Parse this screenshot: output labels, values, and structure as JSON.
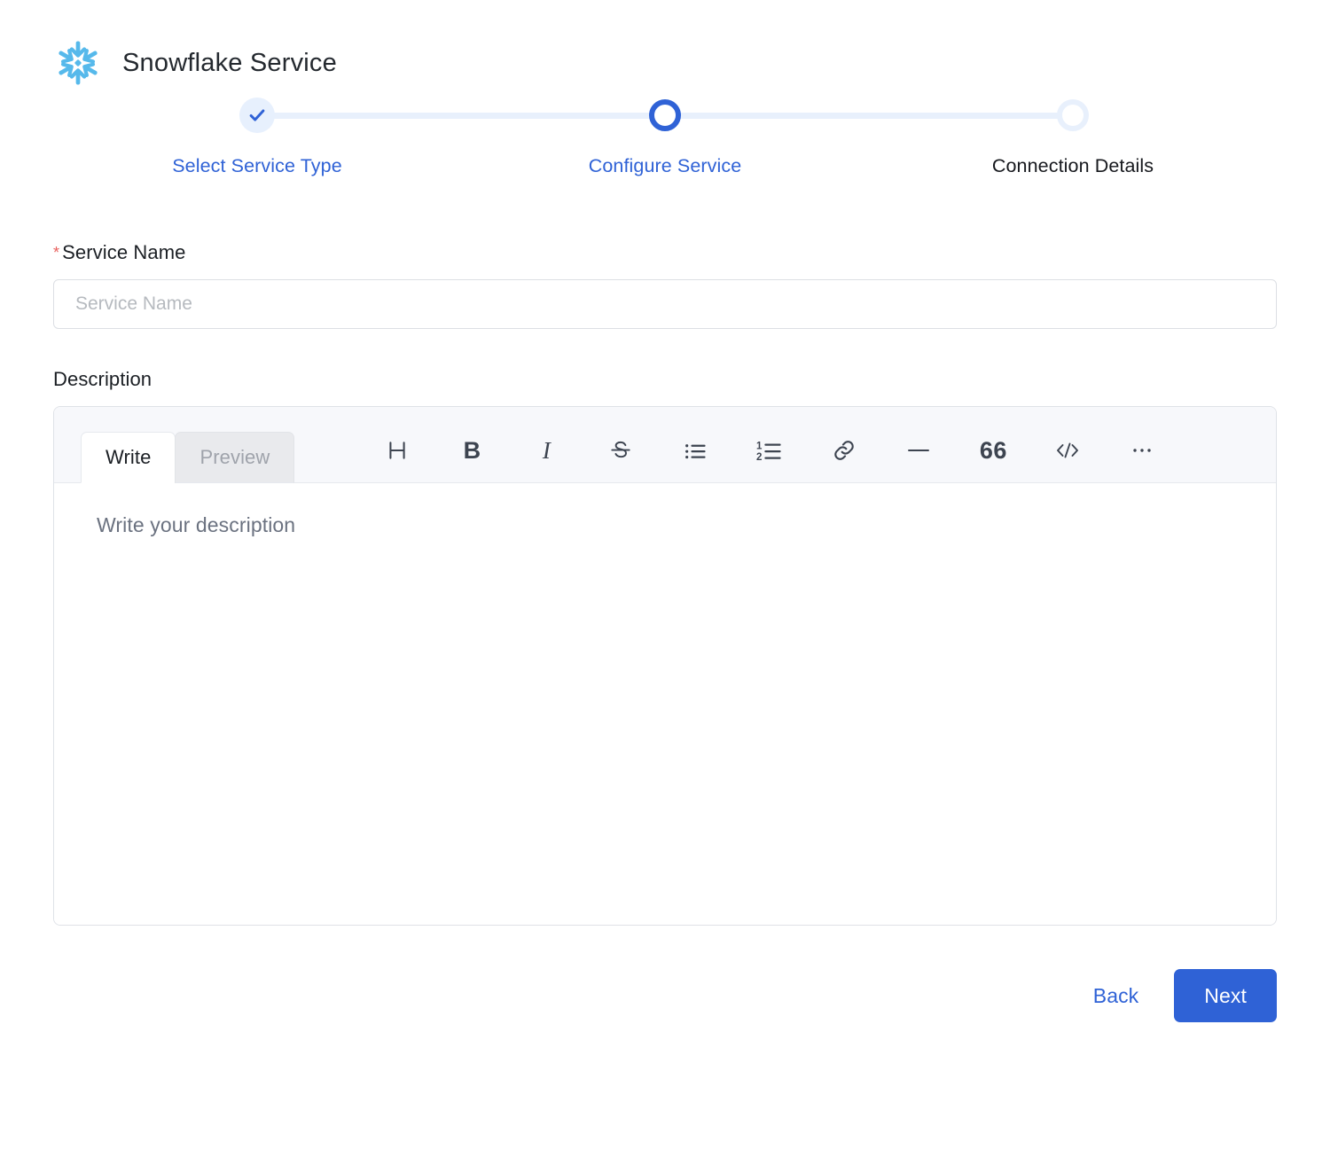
{
  "header": {
    "title": "Snowflake Service",
    "logo_icon": "snowflake-icon",
    "logo_color": "#56b9eb"
  },
  "stepper": {
    "accent_color": "#2f62d6",
    "line_color": "#e8f0fc",
    "steps": [
      {
        "label": "Select Service Type",
        "state": "done",
        "icon": "check-icon"
      },
      {
        "label": "Configure Service",
        "state": "active",
        "icon": "circle-icon"
      },
      {
        "label": "Connection Details",
        "state": "upcoming",
        "icon": "circle-icon"
      }
    ]
  },
  "form": {
    "service_name": {
      "label": "Service Name",
      "required_marker": "*",
      "required_marker_color": "#e8615e",
      "value": "",
      "placeholder": "Service Name"
    },
    "description": {
      "label": "Description",
      "tabs": [
        {
          "label": "Write",
          "active": true
        },
        {
          "label": "Preview",
          "active": false
        }
      ],
      "toolbar": [
        {
          "name": "heading-icon",
          "glyph": "H"
        },
        {
          "name": "bold-icon",
          "glyph": "B"
        },
        {
          "name": "italic-icon",
          "glyph": "I"
        },
        {
          "name": "strikethrough-icon",
          "glyph": "S"
        },
        {
          "name": "bullet-list-icon",
          "glyph": ""
        },
        {
          "name": "numbered-list-icon",
          "glyph": ""
        },
        {
          "name": "link-icon",
          "glyph": ""
        },
        {
          "name": "horizontal-rule-icon",
          "glyph": ""
        },
        {
          "name": "blockquote-icon",
          "glyph": "66"
        },
        {
          "name": "code-icon",
          "glyph": "</>"
        },
        {
          "name": "more-options-icon",
          "glyph": "•••"
        }
      ],
      "body_value": "",
      "body_placeholder": "Write your description"
    }
  },
  "footer": {
    "back_label": "Back",
    "next_label": "Next",
    "next_bg": "#2f62d6"
  }
}
